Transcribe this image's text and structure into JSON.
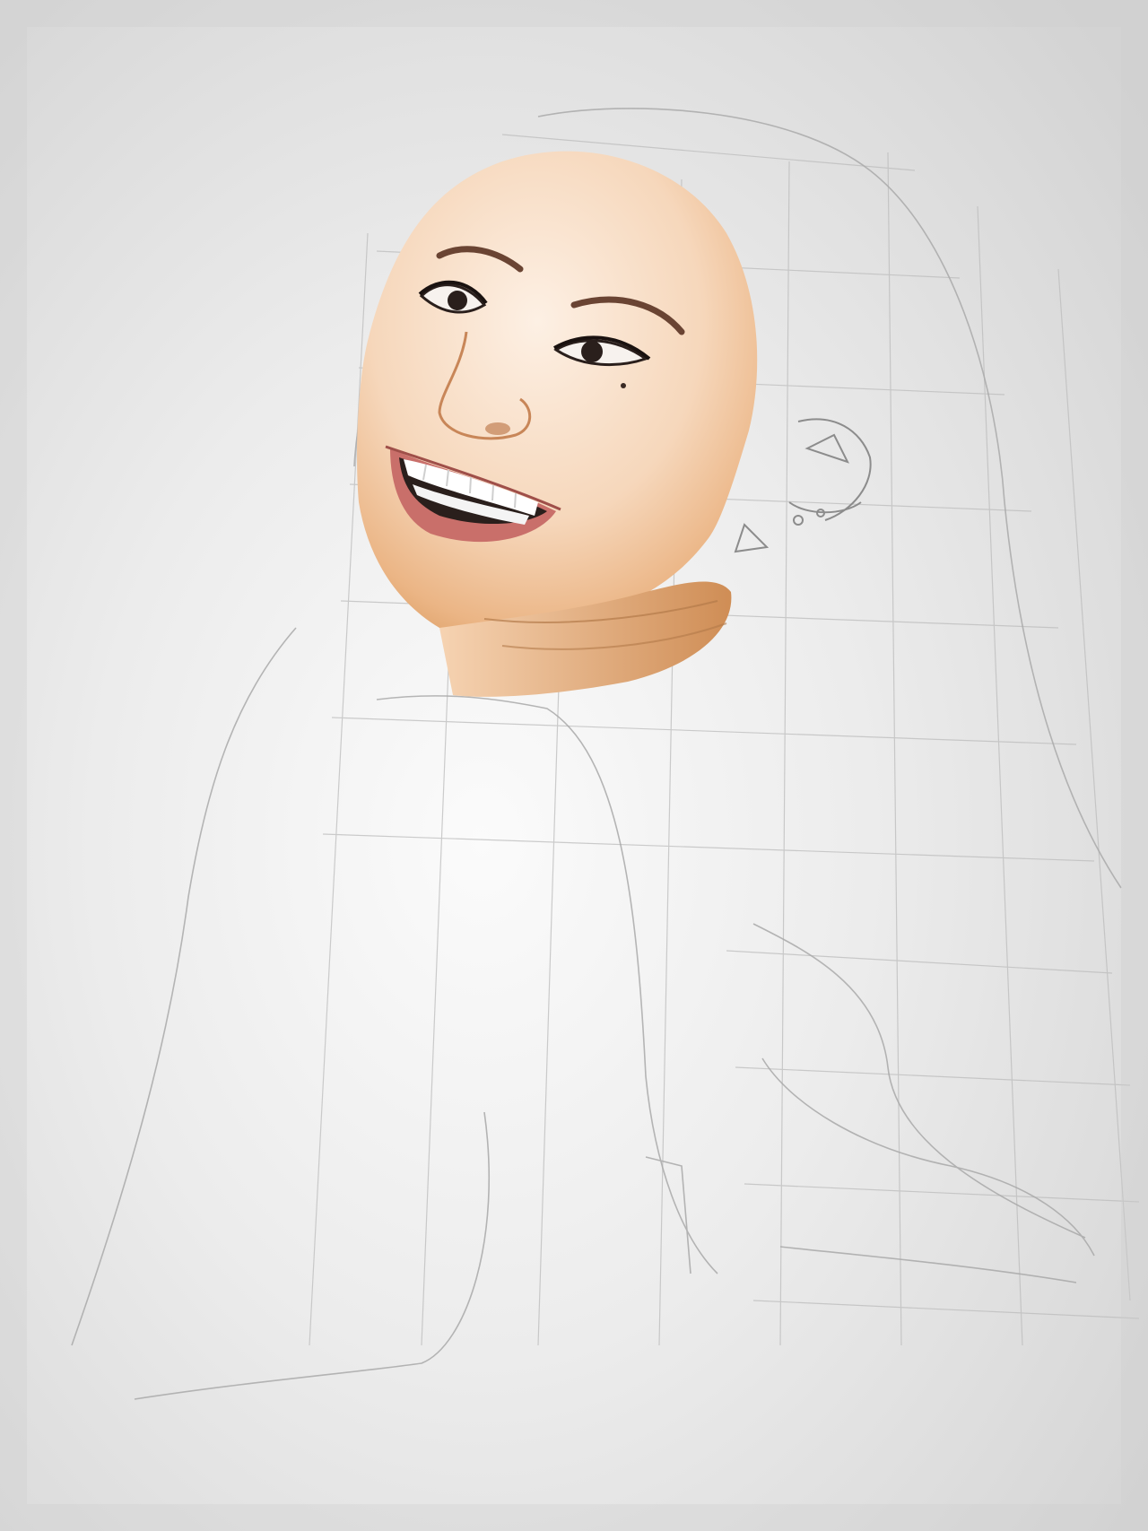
{
  "photo": {
    "subject": "pencil-portrait-work-in-progress",
    "palette": {
      "paper_light": "#f3f3f3",
      "paper_mid": "#e6e6e6",
      "paper_edge": "#cfcfcf",
      "skin_light": "#fbe9da",
      "skin_mid": "#f2c9a4",
      "skin_shadow": "#d8965e",
      "graphite": "#9a9a9a",
      "lip": "#c96f6a",
      "dark": "#2a1f1c"
    }
  }
}
